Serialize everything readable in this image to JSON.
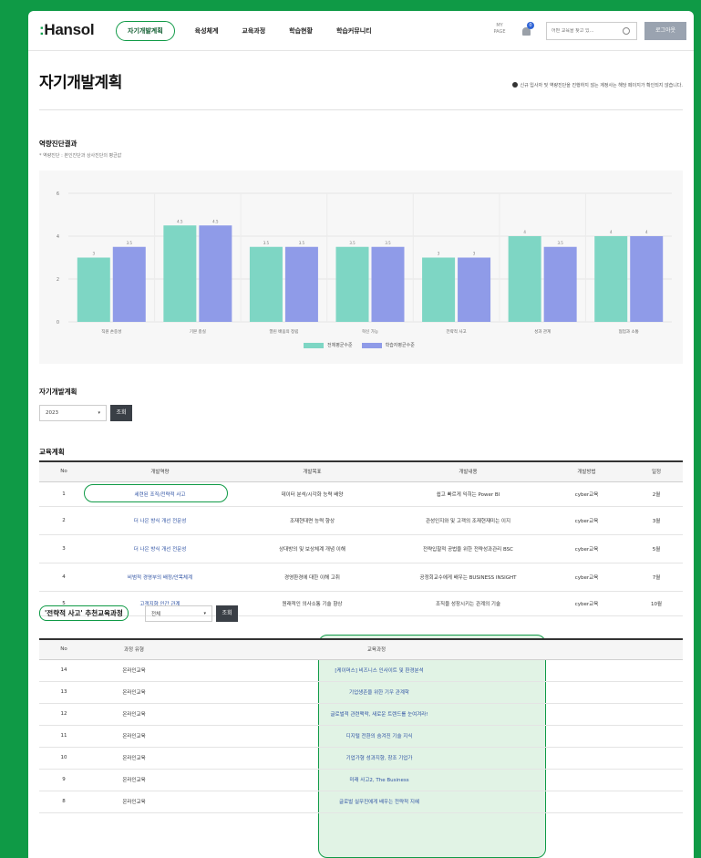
{
  "header": {
    "logo": "Hansol",
    "nav": [
      "자기개발계획",
      "육성체계",
      "교육과정",
      "학습현황",
      "학습커뮤니티"
    ],
    "active_nav": 0,
    "my_icon_label": "MY PAGE",
    "notif_count": "0",
    "search_placeholder": "어떤 교육을 찾고 있… ",
    "logout_label": "로그아웃"
  },
  "page": {
    "title": "자기개발계획",
    "notice": "신규 입사자 및 역량진단을 진행하지 않는 계정사는 해당 페이지가 확인되지 않습니다."
  },
  "competency": {
    "section_title": "역량진단결과",
    "sub_note": "* 역량진단 : 본인진단과 상사진단의 평균값"
  },
  "chart_data": {
    "type": "bar",
    "categories": [
      "직원 손중성",
      "기본 충실",
      "열린 배움의 정립",
      "혁신 가능",
      "전략적 사고",
      "성과 관계",
      "협업과 소통"
    ],
    "series": [
      {
        "name": "전체평균수준",
        "values": [
          3.0,
          4.5,
          3.5,
          3.5,
          3.0,
          4.0,
          4.0
        ]
      },
      {
        "name": "학습자평균수준",
        "values": [
          3.5,
          4.5,
          3.5,
          3.5,
          3.0,
          3.5,
          4.0
        ]
      }
    ],
    "ylim": [
      0,
      6
    ],
    "yticks": [
      "0",
      "2",
      "4",
      "6"
    ],
    "colors": [
      "#7ed6c4",
      "#8f9be8"
    ],
    "legend_position": "bottom"
  },
  "plan": {
    "section_title": "자기개발계획",
    "year": "2023",
    "search_label": "조회"
  },
  "edu_plan": {
    "section_title": "교육계획",
    "columns": [
      "No",
      "개발역량",
      "개발목표",
      "개발내용",
      "개발방법",
      "일정"
    ],
    "rows": [
      [
        "1",
        "세련된 조직/전략적 사고",
        "데이터 분석/시각화 능력 배양",
        "쉽고 빠르게 익히는 Power BI",
        "cyber교육",
        "2월"
      ],
      [
        "2",
        "더 나은 방식 개선 전문성",
        "조재현대면 능력 향상",
        "관성인지와 및 고객의 조재현재미는 이지",
        "cyber교육",
        "3월"
      ],
      [
        "3",
        "더 나은 방식 개선 전문성",
        "상대방의 및 보상체계 개념 이해",
        "전략입찰적 공법을 위한 전략성과관리 BSC",
        "cyber교육",
        "5월"
      ],
      [
        "4",
        "비범적 경영부의 배정/안목체계",
        "경영환경에 대한 이해 고취",
        "공정회교수에게 배우는 BUSINESS INSIGHT",
        "cyber교육",
        "7월"
      ],
      [
        "5",
        "고객지향 인간 관계",
        "원래적인 의사소통 기술 향상",
        "조직을 성장시키는 관계의 기술",
        "cyber교육",
        "10월"
      ]
    ]
  },
  "recommend": {
    "section_title": "'전략적 사고' 추천교육과정",
    "select_value": "전체",
    "search_label": "조회",
    "columns": [
      "No",
      "과정 유형",
      "교육과정"
    ],
    "rows": [
      [
        "14",
        "온라인교육",
        "[케이머스] 비즈니스 인사이트 및 환경분석"
      ],
      [
        "13",
        "온라인교육",
        "기업생존을 위한 기우 관계학"
      ],
      [
        "12",
        "온라인교육",
        "글로벌적 관련맥락, 새로운 트렌드를 눈여겨라!"
      ],
      [
        "11",
        "온라인교육",
        "디지털 전환의 숨겨진 기술 지식"
      ],
      [
        "10",
        "온라인교육",
        "기업가형 성과지향, 창조 기업가"
      ],
      [
        "9",
        "온라인교육",
        "미래 사고2, The Business"
      ],
      [
        "8",
        "온라인교육",
        "글로벌 실무진에게 배우는 전략적 지혜"
      ]
    ]
  }
}
